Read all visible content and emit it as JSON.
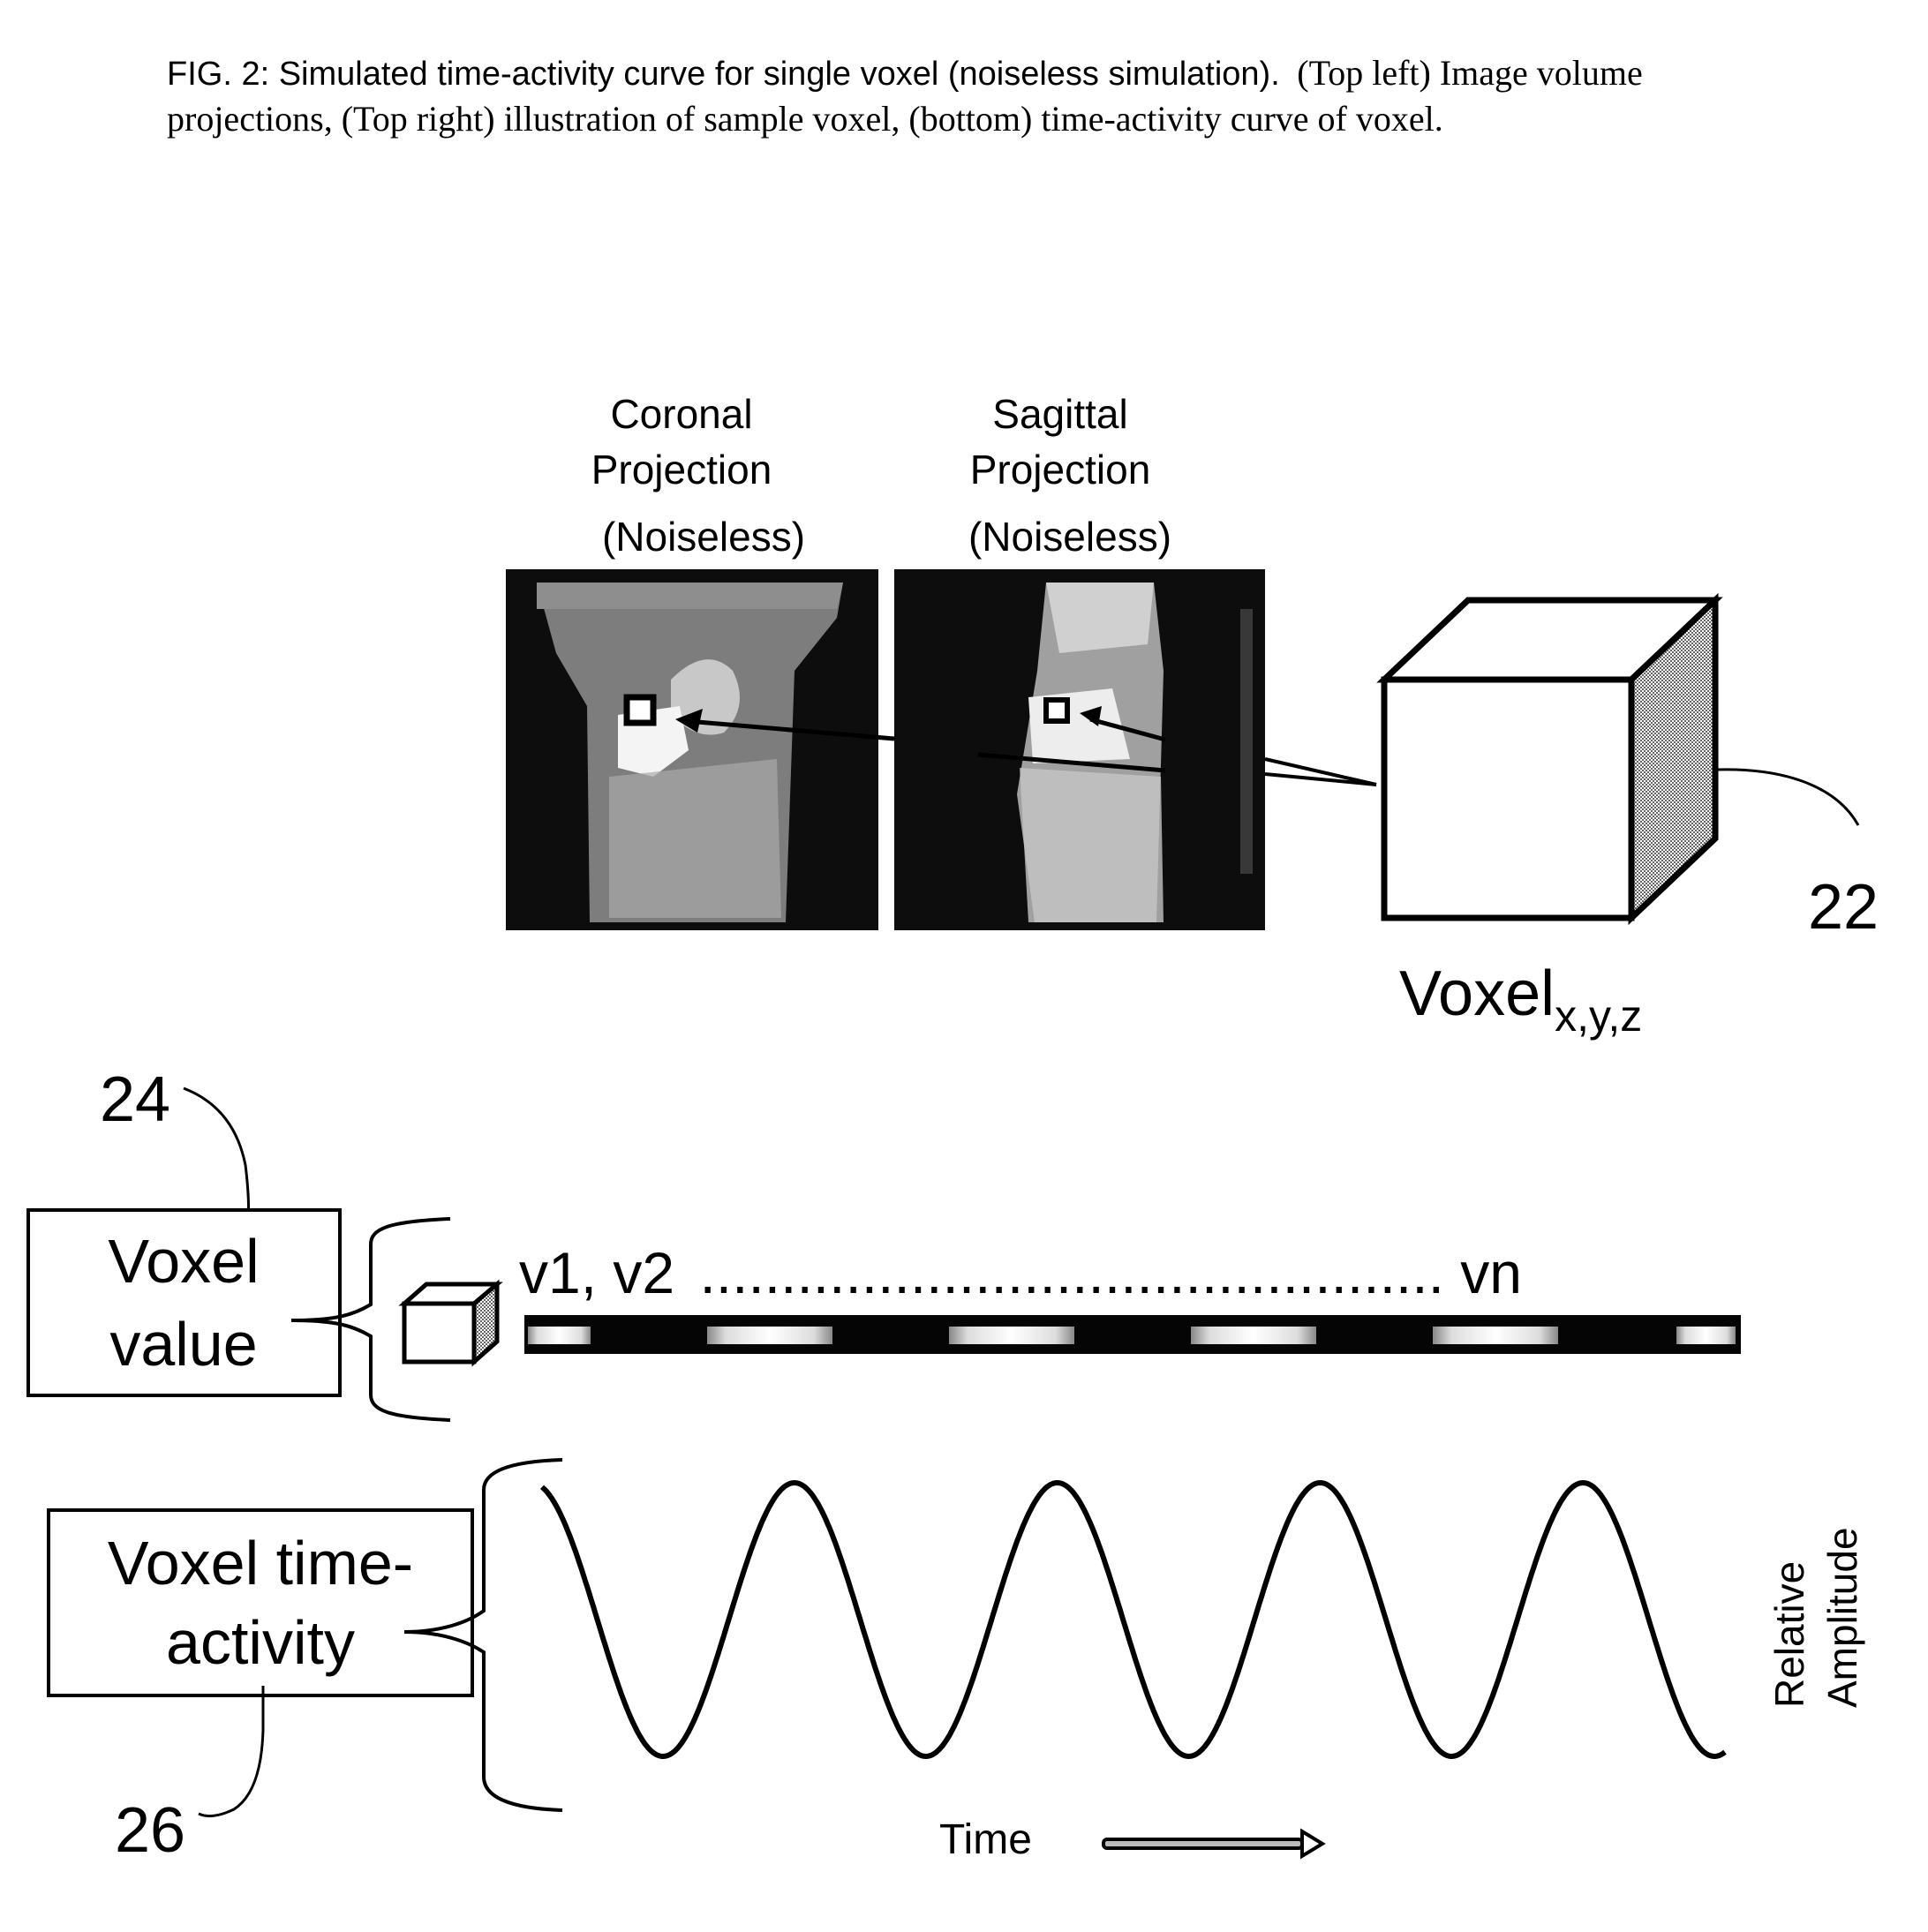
{
  "caption": {
    "line1_sans": "FIG. 2: Simulated time-activity curve for single voxel (noiseless simulation).",
    "line1_serif": "(Top left) Image volume",
    "line2_serif": "projections, (Top right) illustration of sample voxel, (bottom) time-activity curve of voxel."
  },
  "projections": [
    {
      "title_line1": "Coronal",
      "title_line2": "Projection",
      "title_line3": "(Noiseless)"
    },
    {
      "title_line1": "Sagittal",
      "title_line2": "Projection",
      "title_line3": "(Noiseless)"
    }
  ],
  "voxel": {
    "label_main": "Voxel",
    "label_sub": "x,y,z",
    "reference_number": "22"
  },
  "voxel_value": {
    "box_line1": "Voxel",
    "box_line2": "value",
    "reference_number": "24",
    "sequence_start": "v1, v2",
    "sequence_dots": "..............................................",
    "sequence_end": "vn",
    "strip_segments": 6
  },
  "time_activity": {
    "box_line1": "Voxel time-",
    "box_line2": "activity",
    "reference_number": "26",
    "x_label": "Time",
    "y_label_line1": "Relative",
    "y_label_line2": "Amplitude",
    "cycles": 4.5
  },
  "colors": {
    "ink": "#000000",
    "background": "#ffffff",
    "shade": "#9a9a9a",
    "image_dark": "#111111",
    "image_mid": "#8c8c8c",
    "image_light": "#d9d9d9"
  }
}
